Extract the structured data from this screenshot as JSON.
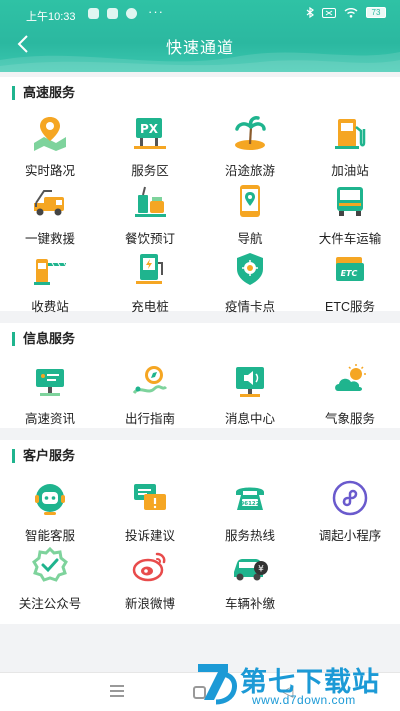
{
  "status_bar": {
    "time": "上午10:33",
    "more": "···",
    "battery": "73"
  },
  "header": {
    "title": "快速通道"
  },
  "sections": [
    {
      "title": "高速服务",
      "items": [
        {
          "label": "实时路况",
          "icon": "map-pin-icon"
        },
        {
          "label": "服务区",
          "icon": "service-area-px-icon"
        },
        {
          "label": "沿途旅游",
          "icon": "palm-island-icon"
        },
        {
          "label": "加油站",
          "icon": "fuel-pump-icon"
        },
        {
          "label": "一键救援",
          "icon": "tow-truck-icon"
        },
        {
          "label": "餐饮预订",
          "icon": "drink-food-icon"
        },
        {
          "label": "导航",
          "icon": "navigation-phone-icon"
        },
        {
          "label": "大件车运输",
          "icon": "big-truck-icon"
        },
        {
          "label": "收费站",
          "icon": "toll-gate-icon"
        },
        {
          "label": "充电桩",
          "icon": "charging-pile-icon"
        },
        {
          "label": "疫情卡点",
          "icon": "epidemic-shield-icon"
        },
        {
          "label": "ETC服务",
          "icon": "etc-card-icon"
        }
      ]
    },
    {
      "title": "信息服务",
      "items": [
        {
          "label": "高速资讯",
          "icon": "news-icon"
        },
        {
          "label": "出行指南",
          "icon": "compass-route-icon"
        },
        {
          "label": "消息中心",
          "icon": "message-board-icon"
        },
        {
          "label": "气象服务",
          "icon": "weather-cloud-icon"
        }
      ]
    },
    {
      "title": "客户服务",
      "items": [
        {
          "label": "智能客服",
          "icon": "robot-headset-icon"
        },
        {
          "label": "投诉建议",
          "icon": "complaint-chat-icon"
        },
        {
          "label": "服务热线",
          "icon": "hotline-phone-icon"
        },
        {
          "label": "调起小程序",
          "icon": "mini-program-icon"
        },
        {
          "label": "关注公众号",
          "icon": "badge-check-icon"
        },
        {
          "label": "新浪微博",
          "icon": "weibo-icon"
        },
        {
          "label": "车辆补缴",
          "icon": "car-payment-icon"
        }
      ]
    }
  ],
  "watermark": {
    "name": "第七下载站",
    "url": "www.d7down.com"
  },
  "colors": {
    "header": "#2bb8a0",
    "accent": "#1fb48e",
    "orange": "#f5a623",
    "watermark": "#1c9ad6"
  }
}
